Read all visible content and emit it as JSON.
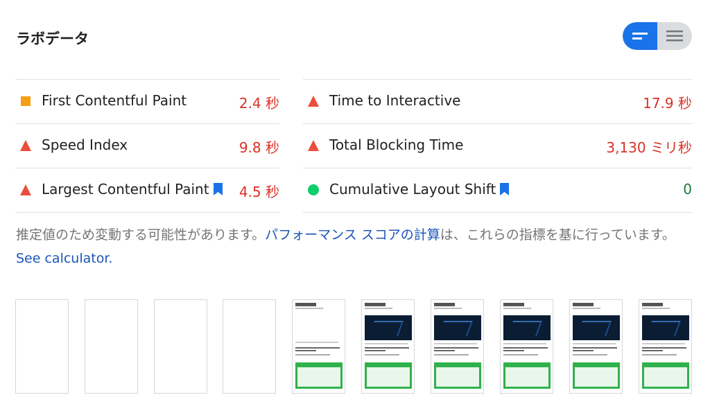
{
  "lab": {
    "title": "ラボデータ"
  },
  "metrics": {
    "left": [
      {
        "label": "First Contentful Paint",
        "value": "2.4 秒",
        "status": "average",
        "icon": "orange-square-icon",
        "bookmark": false
      },
      {
        "label": "Speed Index",
        "value": "9.8 秒",
        "status": "fail",
        "icon": "red-triangle-icon",
        "bookmark": false
      },
      {
        "label": "Largest Contentful Paint",
        "value": "4.5 秒",
        "status": "fail",
        "icon": "red-triangle-icon",
        "bookmark": true
      }
    ],
    "right": [
      {
        "label": "Time to Interactive",
        "value": "17.9 秒",
        "status": "fail",
        "icon": "red-triangle-icon",
        "bookmark": false
      },
      {
        "label": "Total Blocking Time",
        "value": "3,130 ミリ秒",
        "status": "fail",
        "icon": "red-triangle-icon",
        "bookmark": false
      },
      {
        "label": "Cumulative Layout Shift",
        "value": "0",
        "status": "pass",
        "icon": "green-circle-icon",
        "bookmark": true
      }
    ]
  },
  "note": {
    "prefix": "推定値のため変動する可能性があります。",
    "link1": "パフォーマンス スコアの計算",
    "middle": "は、これらの指標を基に行っています。",
    "link2": "See calculator."
  },
  "colors": {
    "fail": "#d93025",
    "average": "#f4a014",
    "pass": "#188038",
    "accent": "#1a73e8"
  },
  "filmstrip": {
    "frames": [
      "blank",
      "blank",
      "blank",
      "blank",
      "text",
      "loaded",
      "loaded",
      "loaded",
      "loaded",
      "loaded"
    ]
  }
}
